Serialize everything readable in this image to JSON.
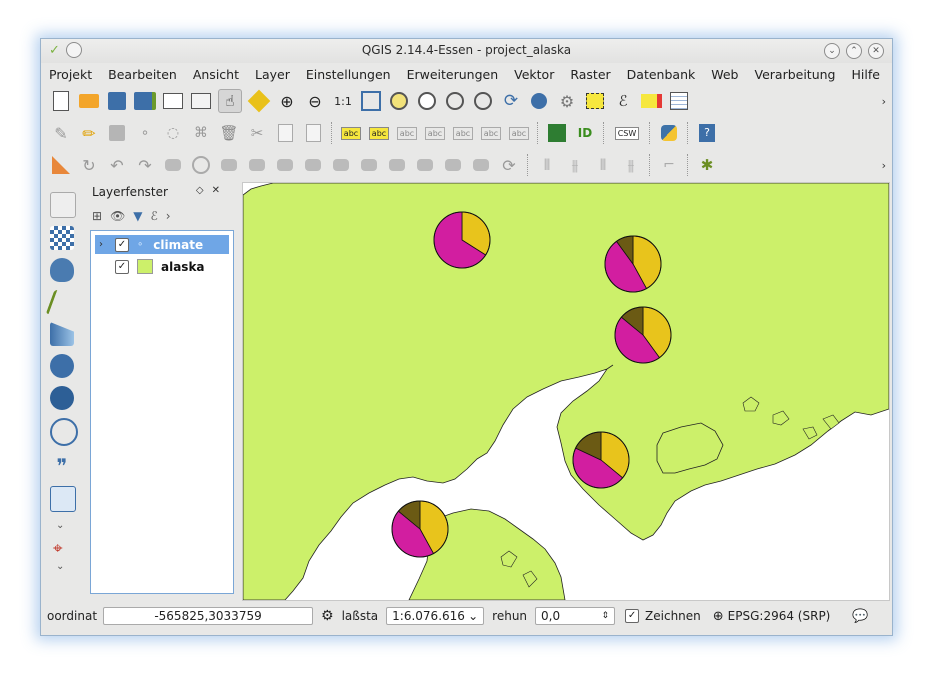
{
  "window": {
    "title": "QGIS 2.14.4-Essen - project_alaska"
  },
  "menu": [
    "Projekt",
    "Bearbeiten",
    "Ansicht",
    "Layer",
    "Einstellungen",
    "Erweiterungen",
    "Vektor",
    "Raster",
    "Datenbank",
    "Web",
    "Verarbeitung",
    "Hilfe"
  ],
  "toolbar1": [
    "new-project",
    "open-project",
    "save-project",
    "save-as",
    "new-print-composer",
    "composer-manager",
    "pan-map",
    "pan-to-selection",
    "zoom-in",
    "zoom-out",
    "zoom-actual",
    "zoom-full",
    "zoom-to-selection",
    "zoom-to-layer",
    "zoom-last",
    "zoom-next",
    "refresh",
    "identify",
    "run-action",
    "select-features",
    "select-by-expression",
    "deselect",
    "attribute-table"
  ],
  "toolbar2_labels": {
    "abc": "abc",
    "csw": "CSW",
    "id": "ID",
    "help": "?"
  },
  "layers_panel": {
    "title": "Layerfenster",
    "layers": [
      {
        "name": "climate",
        "checked": true,
        "selected": true
      },
      {
        "name": "alaska",
        "checked": true,
        "selected": false,
        "swatch": "#ccf06a"
      }
    ]
  },
  "map": {
    "land_color": "#ccf06a",
    "pie_colors": [
      "#e8c41c",
      "#d21ea0",
      "#6b5a14"
    ],
    "pies": [
      {
        "slices": [
          0.34,
          0.66,
          0.0
        ]
      },
      {
        "slices": [
          0.42,
          0.48,
          0.1
        ]
      },
      {
        "slices": [
          0.4,
          0.46,
          0.14
        ]
      },
      {
        "slices": [
          0.36,
          0.46,
          0.18
        ]
      },
      {
        "slices": [
          0.42,
          0.44,
          0.14
        ]
      }
    ]
  },
  "status": {
    "coord_label": "oordinat",
    "coord_value": "-565825,3033759",
    "scale_label": "laßsta",
    "scale_value": "1:6.076.616",
    "rotation_label": "rehun",
    "rotation_value": "0,0",
    "render_label": "Zeichnen",
    "crs": "EPSG:2964 (SRP)"
  }
}
